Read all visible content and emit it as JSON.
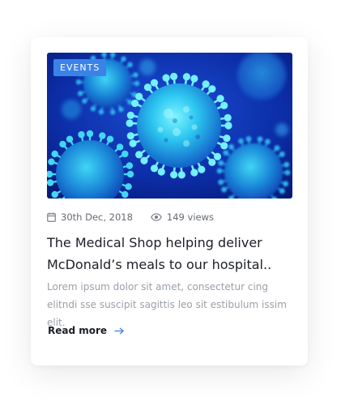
{
  "post": {
    "category": "EVENTS",
    "image_subject": "virus particles illustration",
    "date": "30th Dec, 2018",
    "views": "149 views",
    "title": "The Medical Shop helping deliver McDonald’s meals to our hospital..",
    "excerpt": "Lorem ipsum dolor sit amet, consectetur cing elitndi sse suscipit sagittis leo sit estibulum issim elit.",
    "read_more_label": "Read more"
  },
  "colors": {
    "tag_bg": "#3b82e8",
    "accent": "#3b82e8",
    "title": "#1c1f26",
    "excerpt": "#9aa0a8",
    "meta": "#666b73"
  },
  "icons": {
    "date": "calendar-icon",
    "views": "eye-icon",
    "read_more": "arrow-right-icon"
  }
}
